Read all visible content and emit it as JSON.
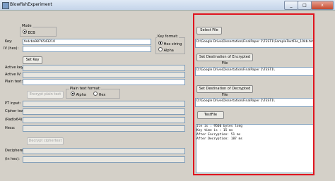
{
  "window": {
    "title": "BlowfishExperiment",
    "min": "_",
    "max": "□",
    "close": "x"
  },
  "mode": {
    "label": "Mode",
    "option": "ECB"
  },
  "key": {
    "label": "Key:",
    "value": "fedcba9876543210"
  },
  "iv": {
    "label": "IV (hex):",
    "value": ""
  },
  "key_format": {
    "label": "Key format:",
    "options": [
      "Hex string",
      "Alpha"
    ]
  },
  "set_key_button": "Set Key",
  "active_key": {
    "label": "Active key:"
  },
  "active_iv": {
    "label": "Active IV:"
  },
  "plain_text": {
    "label": "Plain text:"
  },
  "encrypt_plain_button": "Encrypt plain text",
  "plain_text_format": {
    "label": "Plain text format:",
    "options": [
      "Alpha",
      "Hex"
    ]
  },
  "pt_input": {
    "label": "PT input:"
  },
  "cipher_text": {
    "label": "Cipher text:"
  },
  "radix64": {
    "label": "(Radix64)"
  },
  "hexa": {
    "label": "Hexa:"
  },
  "decrypt_cipher_button": "Decrypt ciphertext",
  "deciphered": {
    "label": "Deciphered:"
  },
  "in_hex": {
    "label": "(in hex):"
  },
  "file_panel": {
    "select_file_button": "Select File",
    "file_path": "D:\\Google Drive\\Dissertation\\FinalPaper 1\\TEST1\\SampleTextFile_10kb.txt",
    "set_dest_encrypted_button": "Set Destination of Encrypted File",
    "enc_path": "D:\\Google Drive\\Dissertation\\FinalPaper 1\\TEST1\\",
    "set_dest_decrypted_button": "Set Destination of Decrypted File",
    "dec_path": "D:\\Google Drive\\Dissertation\\FinalPaper 1\\TEST1\\",
    "test_file_button": "TestFile",
    "log_lines": [
      "ile is : 9560 bytes long",
      "Key time is : 15 ms",
      "After Encryption: 51 ms",
      "After Decryption: 187 ms"
    ]
  }
}
